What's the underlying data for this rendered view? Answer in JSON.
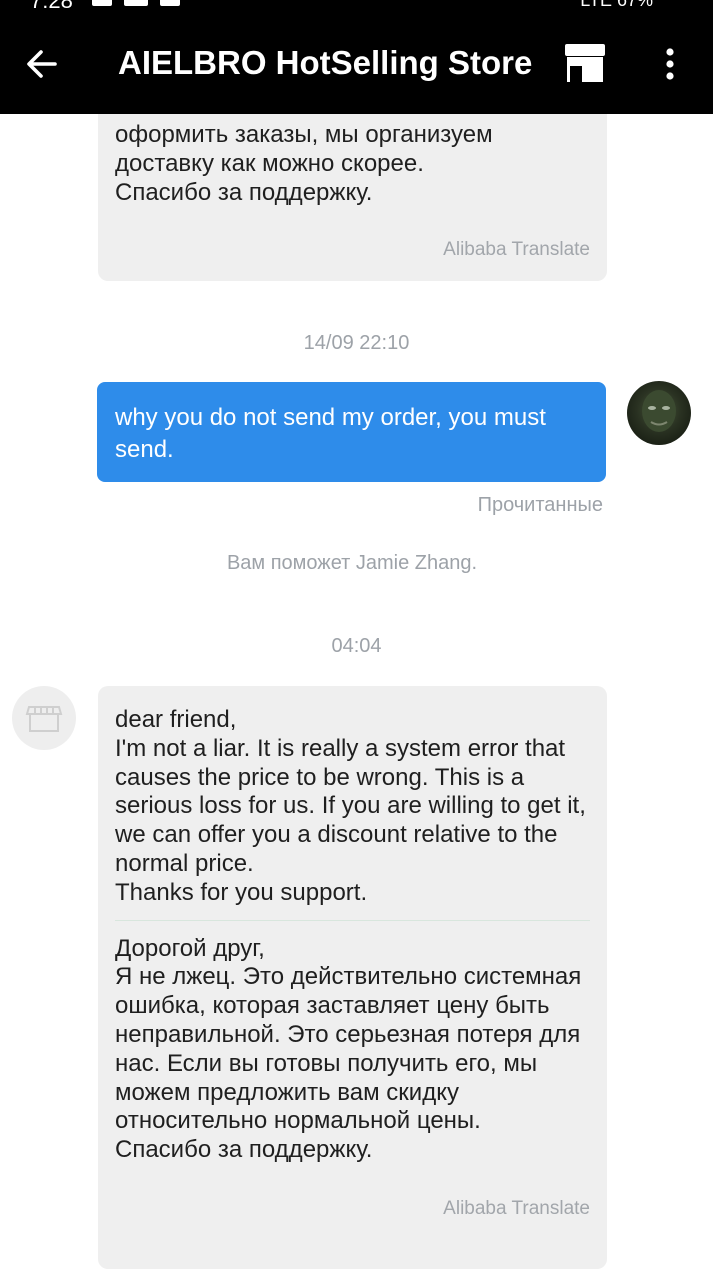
{
  "status_bar": {
    "time": "7:28",
    "right_text": "LTE  67%"
  },
  "header": {
    "title": "AIELBRO HotSelling Store"
  },
  "messages": {
    "top_partial": {
      "text": "оформить заказы, мы организуем\nдоставку как можно скорее.\nСпасибо за поддержку.",
      "translate_label": "Alibaba Translate"
    },
    "timestamp_1": "14/09 22:10",
    "outgoing": {
      "text": "why you do not send my order, you must send.",
      "status": "Прочитанные"
    },
    "system_note": "Вам поможет Jamie Zhang.",
    "timestamp_2": "04:04",
    "incoming": {
      "original": "dear friend,\nI'm not a liar. It is really a system error that causes the price to be wrong. This is a serious loss for us. If you are willing to get it, we can offer you a discount relative to the normal price.\nThanks for you support.",
      "translated": "Дорогой друг,\nЯ не лжец. Это действительно системная ошибка, которая заставляет цену быть неправильной. Это серьезная потеря для нас. Если вы готовы получить его, мы можем предложить вам скидку относительно нормальной цены.\nСпасибо за поддержку.",
      "translate_label": "Alibaba Translate"
    }
  }
}
